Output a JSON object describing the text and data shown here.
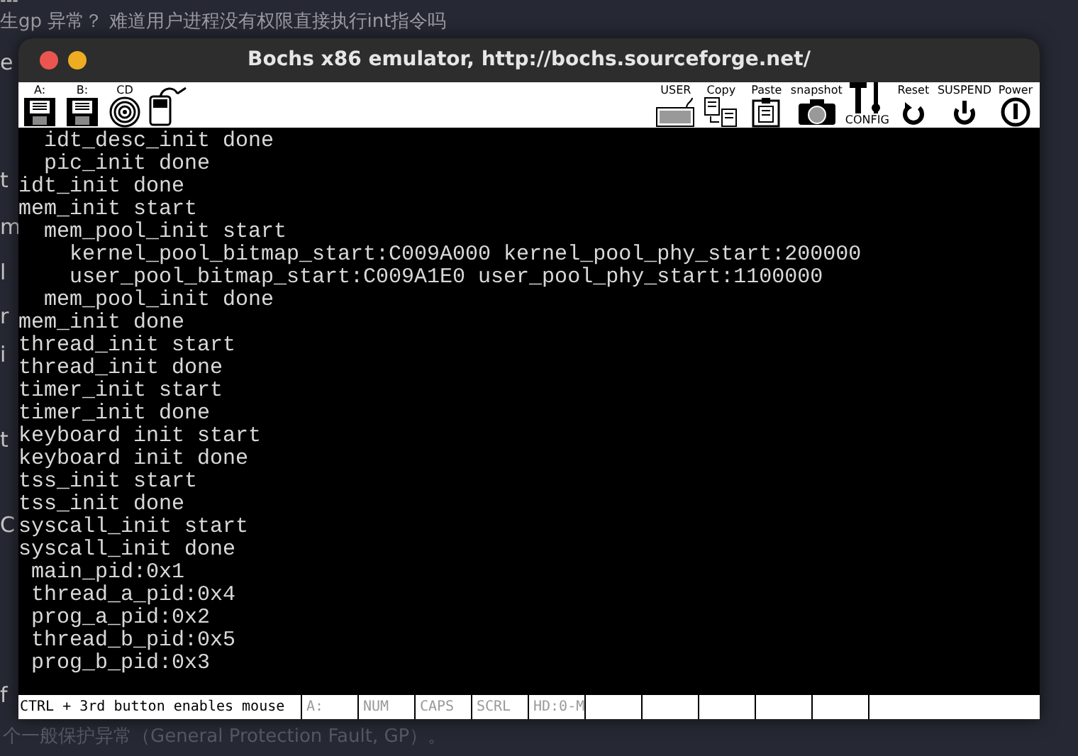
{
  "background": {
    "top_lines": [
      "---",
      "生gp 异常？ 难道用户进程没有权限直接执行int指令吗"
    ],
    "edge_fragments": [
      "e",
      "t",
      "m",
      "l",
      "r",
      "i",
      "t",
      "C",
      "f"
    ],
    "bottom_line": "个一般保护异常（General Protection Fault, GP）。"
  },
  "window": {
    "title": "Bochs x86 emulator, http://bochs.sourceforge.net/"
  },
  "toolbar": {
    "left": [
      {
        "kind": "floppy",
        "label": "A:"
      },
      {
        "kind": "floppy",
        "label": "B:"
      },
      {
        "kind": "cdrom",
        "label": "CD"
      },
      {
        "kind": "mouse"
      }
    ],
    "right": [
      {
        "kind": "keyboard",
        "label": "USER"
      },
      {
        "kind": "copy",
        "label": "Copy"
      },
      {
        "kind": "paste",
        "label": "Paste"
      },
      {
        "kind": "camera",
        "label": "snapshot"
      },
      {
        "kind": "config",
        "label": "CONFIG"
      },
      {
        "kind": "reset",
        "label": "Reset"
      },
      {
        "kind": "suspend",
        "label": "SUSPEND"
      },
      {
        "kind": "power",
        "label": "Power"
      }
    ]
  },
  "console": {
    "lines": [
      "  idt_desc_init done",
      "  pic_init done",
      "idt_init done",
      "mem_init start",
      "  mem_pool_init start",
      "    kernel_pool_bitmap_start:C009A000 kernel_pool_phy_start:200000",
      "    user_pool_bitmap_start:C009A1E0 user_pool_phy_start:1100000",
      "  mem_pool_init done",
      "mem_init done",
      "thread_init start",
      "thread_init done",
      "timer_init start",
      "timer_init done",
      "keyboard init start",
      "keyboard init done",
      "tss_init start",
      "tss_init done",
      "syscall_init start",
      "syscall_init done",
      " main_pid:0x1",
      " thread_a_pid:0x4",
      " prog_a_pid:0x2",
      " thread_b_pid:0x5",
      " prog_b_pid:0x3"
    ]
  },
  "status_bar": {
    "message": "CTRL + 3rd button enables mouse",
    "indicators": [
      {
        "label": "A:",
        "on": false
      },
      {
        "label": "NUM",
        "on": false
      },
      {
        "label": "CAPS",
        "on": false
      },
      {
        "label": "SCRL",
        "on": false
      },
      {
        "label": "HD:0-M",
        "on": false
      }
    ]
  }
}
